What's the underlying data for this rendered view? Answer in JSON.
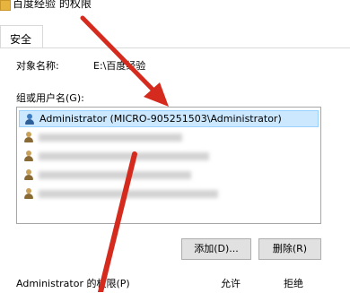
{
  "window": {
    "title": "百度经验 的权限"
  },
  "tabs": [
    {
      "label": "安全"
    }
  ],
  "object": {
    "label": "对象名称:",
    "value": "E:\\百度经验"
  },
  "groups": {
    "label": "组或用户名(G):",
    "items": [
      {
        "label": "Administrator (MICRO-905251503\\Administrator)",
        "icon": "user-icon",
        "selected": true
      }
    ]
  },
  "buttons": {
    "add": "添加(D)...",
    "remove": "删除(R)"
  },
  "permissions": {
    "label": "Administrator 的权限(P)",
    "allow": "允许",
    "deny": "拒绝"
  },
  "colors": {
    "selected": "#cce8ff",
    "arrow": "#d52b1e"
  }
}
